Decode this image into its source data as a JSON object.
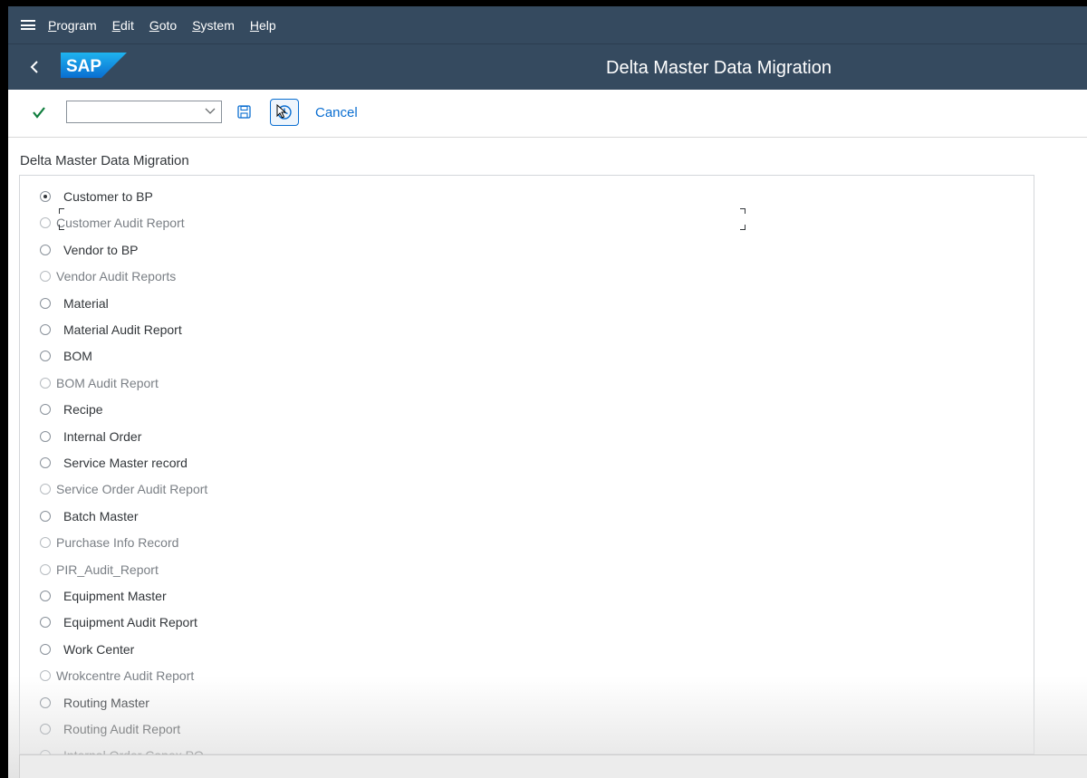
{
  "menu": {
    "items": [
      {
        "mnemonic": "P",
        "rest": "rogram"
      },
      {
        "mnemonic": "E",
        "rest": "dit"
      },
      {
        "mnemonic": "G",
        "rest": "oto"
      },
      {
        "mnemonic": "S",
        "rest": "ystem"
      },
      {
        "mnemonic": "H",
        "rest": "elp"
      }
    ]
  },
  "shell": {
    "logo_text": "SAP",
    "title": "Delta Master Data Migration"
  },
  "toolbar": {
    "command_value": "",
    "cancel_label": "Cancel"
  },
  "group": {
    "title": "Delta Master Data Migration",
    "options": [
      {
        "label": "Customer to BP",
        "checked": true,
        "enabled": true
      },
      {
        "label": "Customer Audit Report",
        "checked": false,
        "enabled": false
      },
      {
        "label": "Vendor to BP",
        "checked": false,
        "enabled": true
      },
      {
        "label": "Vendor Audit Reports",
        "checked": false,
        "enabled": false
      },
      {
        "label": "Material",
        "checked": false,
        "enabled": true
      },
      {
        "label": "Material Audit Report",
        "checked": false,
        "enabled": true
      },
      {
        "label": "BOM",
        "checked": false,
        "enabled": true
      },
      {
        "label": "BOM Audit Report",
        "checked": false,
        "enabled": false
      },
      {
        "label": "Recipe",
        "checked": false,
        "enabled": true
      },
      {
        "label": "Internal Order",
        "checked": false,
        "enabled": true
      },
      {
        "label": "Service Master record",
        "checked": false,
        "enabled": true
      },
      {
        "label": "Service Order Audit Report",
        "checked": false,
        "enabled": false
      },
      {
        "label": "Batch Master",
        "checked": false,
        "enabled": true
      },
      {
        "label": "Purchase Info Record",
        "checked": false,
        "enabled": false
      },
      {
        "label": "PIR_Audit_Report",
        "checked": false,
        "enabled": false
      },
      {
        "label": "Equipment Master",
        "checked": false,
        "enabled": true
      },
      {
        "label": "Equipment Audit Report",
        "checked": false,
        "enabled": true
      },
      {
        "label": "Work Center",
        "checked": false,
        "enabled": true
      },
      {
        "label": "Wrokcentre Audit Report",
        "checked": false,
        "enabled": false
      },
      {
        "label": "Routing Master",
        "checked": false,
        "enabled": true
      },
      {
        "label": "Routing Audit Report",
        "checked": false,
        "enabled": true
      },
      {
        "label": "Internal Order Capex PO",
        "checked": false,
        "enabled": true
      }
    ]
  },
  "colors": {
    "shell_bg": "#354a5f",
    "accent": "#0a6ed1",
    "check_green": "#107e3e"
  }
}
